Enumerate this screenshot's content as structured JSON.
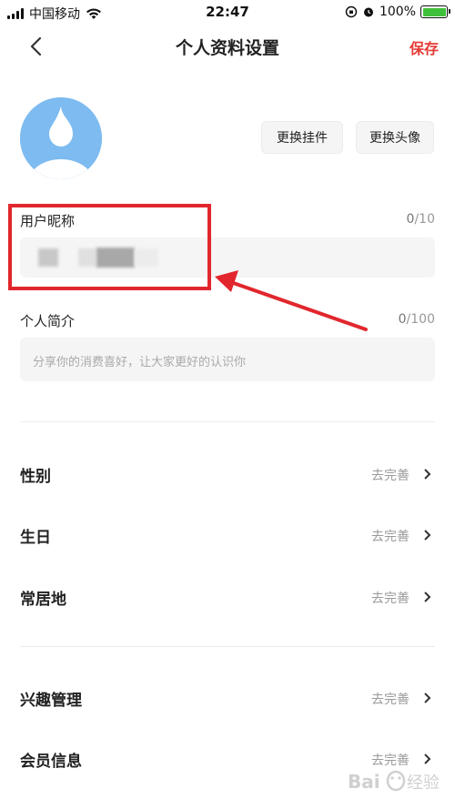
{
  "status_bar": {
    "carrier": "中国移动",
    "time": "22:47",
    "battery": "100%",
    "battery_color": "#3fc03a"
  },
  "navbar": {
    "title": "个人资料设置",
    "save_label": "保存",
    "save_color": "#e53935",
    "back_icon": "chevron-left-icon"
  },
  "avatar": {
    "color": "#7dbbf0",
    "change_pendant_label": "更换挂件",
    "change_avatar_label": "更换头像"
  },
  "nickname": {
    "label": "用户昵称",
    "count": "0",
    "max": "/10"
  },
  "bio": {
    "label": "个人简介",
    "count": "0",
    "max": "/100",
    "placeholder": "分享你的消费喜好，让大家更好的认识你"
  },
  "rows_group1": [
    {
      "label": "性别",
      "value": "去完善"
    },
    {
      "label": "生日",
      "value": "去完善"
    },
    {
      "label": "常居地",
      "value": "去完善"
    }
  ],
  "rows_group2": [
    {
      "label": "兴趣管理",
      "value": "去完善"
    },
    {
      "label": "会员信息",
      "value": "去完善"
    }
  ],
  "annotation": {
    "highlight_color": "#e1272d"
  },
  "watermark": {
    "text": "Baidu经验"
  }
}
